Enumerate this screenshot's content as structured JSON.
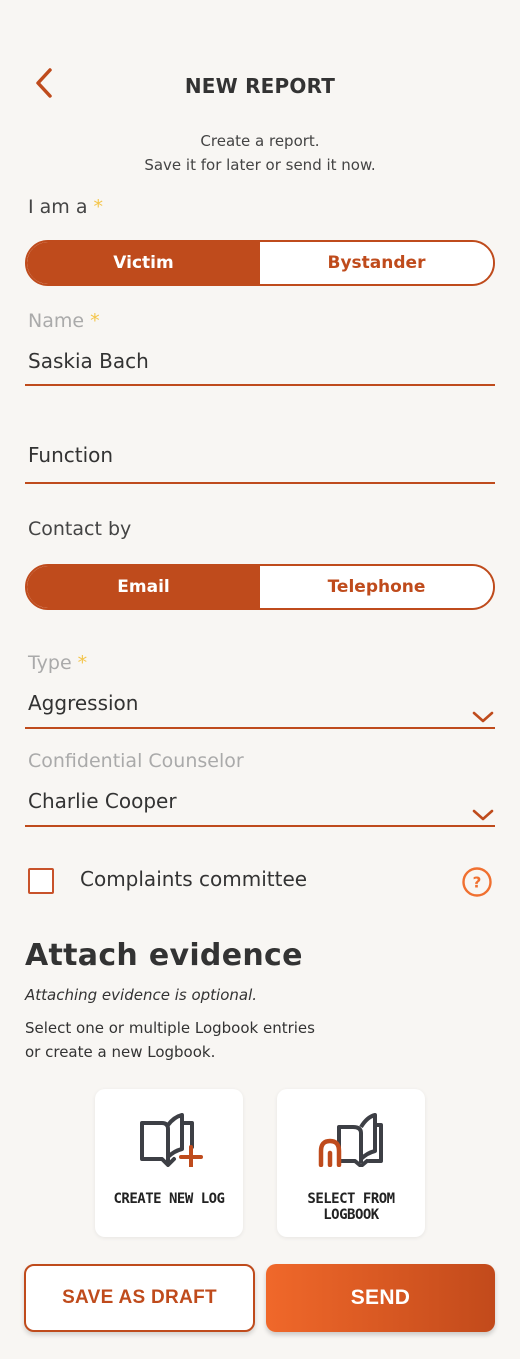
{
  "header": {
    "title": "NEW REPORT",
    "subtitle_line1": "Create a report.",
    "subtitle_line2": "Save it for later or send it now."
  },
  "role": {
    "label": "I am a",
    "required_mark": "*",
    "options": [
      "Victim",
      "Bystander"
    ],
    "selected": "Victim"
  },
  "name_field": {
    "label": "Name",
    "required_mark": "*",
    "value": "Saskia Bach"
  },
  "function_field": {
    "placeholder": "Function"
  },
  "contact": {
    "label": "Contact by",
    "options": [
      "Email",
      "Telephone"
    ],
    "selected": "Email"
  },
  "type_select": {
    "label": "Type",
    "required_mark": "*",
    "value": "Aggression"
  },
  "counselor_select": {
    "label": "Confidential Counselor",
    "value": "Charlie Cooper"
  },
  "complaints": {
    "label": "Complaints committee",
    "checked": false,
    "help_icon": "question-circle-icon"
  },
  "evidence": {
    "title": "Attach evidence",
    "optional_note": "Attaching evidence is optional.",
    "desc_line1": "Select one or multiple Logbook entries",
    "desc_line2": "or create a new Logbook.",
    "create_label": "CREATE NEW LOG",
    "select_label_line1": "SELECT FROM",
    "select_label_line2": "LOGBOOK"
  },
  "actions": {
    "draft_label": "SAVE AS DRAFT",
    "send_label": "SEND"
  },
  "colors": {
    "accent": "#bf4b1c",
    "send_gradient_start": "#f0682a",
    "required_star": "#f4c54a",
    "background": "#f8f6f3"
  }
}
